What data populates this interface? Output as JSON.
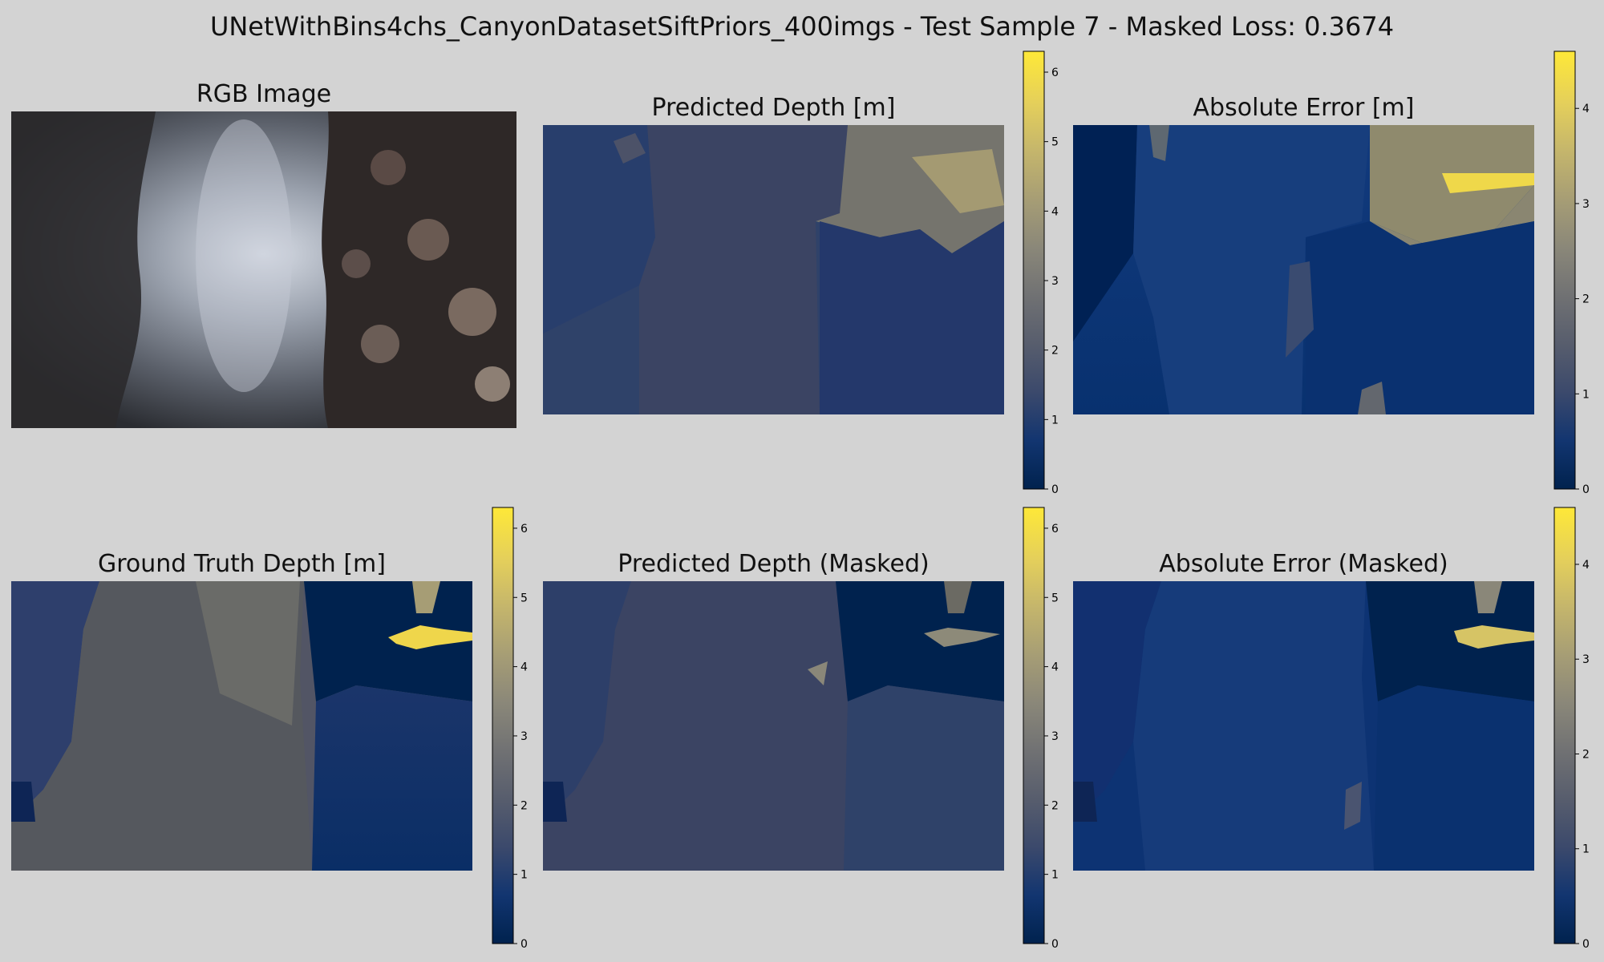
{
  "figure": {
    "title": "UNetWithBins4chs_CanyonDatasetSiftPriors_400imgs - Test Sample 7 - Masked Loss: 0.3674"
  },
  "panels": {
    "rgb": {
      "title": "RGB Image"
    },
    "pred": {
      "title": "Predicted Depth [m]"
    },
    "err": {
      "title": "Absolute Error [m]"
    },
    "gt": {
      "title": "Ground Truth Depth [m]"
    },
    "pred_masked": {
      "title": "Predicted Depth (Masked)"
    },
    "err_masked": {
      "title": "Absolute Error (Masked)"
    }
  },
  "colormap": {
    "name": "cividis",
    "stops": [
      "#00224e",
      "#123570",
      "#3b496c",
      "#575d6d",
      "#707173",
      "#8a8779",
      "#a69d75",
      "#c4b56c",
      "#e4cf5b",
      "#fee838"
    ]
  },
  "chart_data": [
    {
      "type": "heatmap",
      "id": "pred",
      "title": "Predicted Depth [m]",
      "colorbar": {
        "ticks": [
          "0",
          "1",
          "2",
          "3",
          "4",
          "5",
          "6"
        ],
        "range": [
          0,
          6.3
        ]
      }
    },
    {
      "type": "heatmap",
      "id": "err",
      "title": "Absolute Error [m]",
      "colorbar": {
        "ticks": [
          "0",
          "1",
          "2",
          "3",
          "4"
        ],
        "range": [
          0,
          4.6
        ]
      }
    },
    {
      "type": "heatmap",
      "id": "gt",
      "title": "Ground Truth Depth [m]",
      "colorbar": {
        "ticks": [
          "0",
          "1",
          "2",
          "3",
          "4",
          "5",
          "6"
        ],
        "range": [
          0,
          6.3
        ]
      }
    },
    {
      "type": "heatmap",
      "id": "pred_masked",
      "title": "Predicted Depth (Masked)",
      "colorbar": {
        "ticks": [
          "0",
          "1",
          "2",
          "3",
          "4",
          "5",
          "6"
        ],
        "range": [
          0,
          6.3
        ]
      }
    },
    {
      "type": "heatmap",
      "id": "err_masked",
      "title": "Absolute Error (Masked)",
      "colorbar": {
        "ticks": [
          "0",
          "1",
          "2",
          "3",
          "4"
        ],
        "range": [
          0,
          4.6
        ]
      }
    }
  ]
}
